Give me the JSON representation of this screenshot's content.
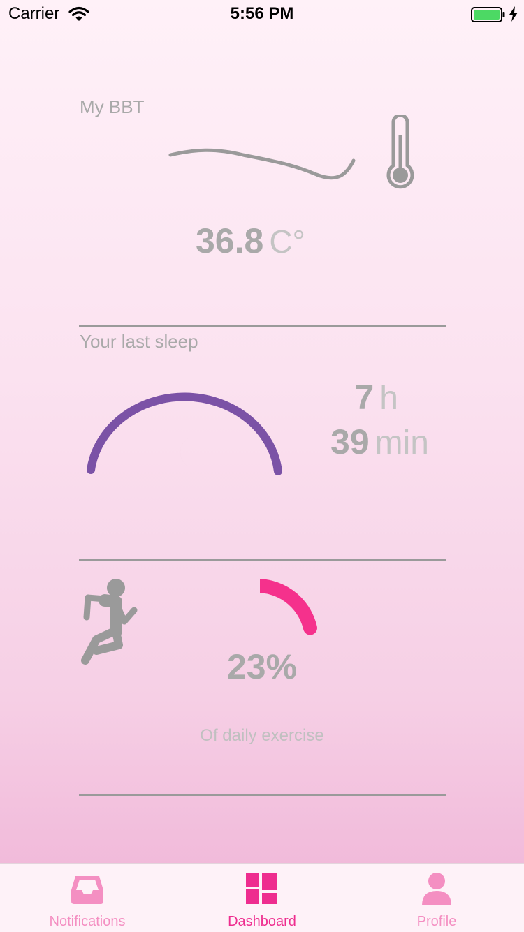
{
  "status_bar": {
    "carrier": "Carrier",
    "time": "5:56 PM",
    "battery_color": "#4cd964"
  },
  "bbt": {
    "title": "My BBT",
    "value": "36.8",
    "unit": "C°"
  },
  "sleep": {
    "title": "Your last sleep",
    "hours": "7",
    "hours_unit": "h",
    "minutes": "39",
    "minutes_unit": "min",
    "gauge_color": "#7b52a6"
  },
  "exercise": {
    "percent": "23%",
    "progress": 0.23,
    "caption": "Of daily exercise",
    "gauge_color": "#f5318c"
  },
  "tabs": [
    {
      "label": "Notifications",
      "icon": "inbox-tray-icon",
      "active": false
    },
    {
      "label": "Dashboard",
      "icon": "dashboard-grid-icon",
      "active": true
    },
    {
      "label": "Profile",
      "icon": "person-icon",
      "active": false
    }
  ],
  "colors": {
    "accent": "#ee2d8f",
    "tab_inactive": "#f48fc2",
    "text_gray": "#a9a9a9"
  }
}
